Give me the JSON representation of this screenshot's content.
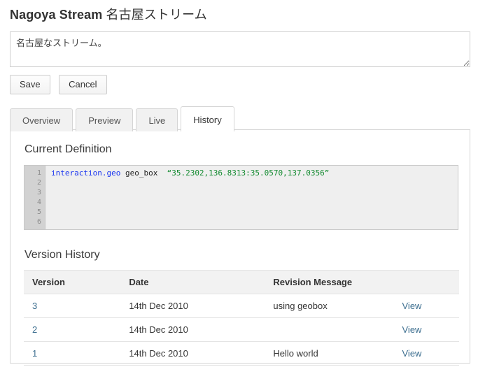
{
  "page": {
    "title_en": "Nagoya Stream ",
    "title_jp": "名古屋ストリーム"
  },
  "description": {
    "value": "名古屋なストリーム。",
    "placeholder": ""
  },
  "actions": {
    "save_label": "Save",
    "cancel_label": "Cancel"
  },
  "tabs": [
    {
      "label": "Overview",
      "active": false
    },
    {
      "label": "Preview",
      "active": false
    },
    {
      "label": "Live",
      "active": false
    },
    {
      "label": "History",
      "active": true
    }
  ],
  "current_definition": {
    "heading": "Current Definition",
    "line_numbers": [
      "1",
      "2",
      "3",
      "4",
      "5",
      "6"
    ],
    "code": {
      "namespace": "interaction.geo",
      "keyword": "geo_box",
      "string": "“35.2302,136.8313:35.0570,137.0356”"
    }
  },
  "version_history": {
    "heading": "Version History",
    "columns": [
      "Version",
      "Date",
      "Revision Message",
      ""
    ],
    "rows": [
      {
        "version": "3",
        "date": "14th Dec 2010",
        "message": "using geobox",
        "action": "View"
      },
      {
        "version": "2",
        "date": "14th Dec 2010",
        "message": "",
        "action": "View"
      },
      {
        "version": "1",
        "date": "14th Dec 2010",
        "message": "Hello world",
        "action": "View"
      }
    ]
  },
  "colors": {
    "link": "#3c6e8f",
    "code_namespace": "#1a35f0",
    "code_string": "#128a2f",
    "panel_border": "#d5d5d5",
    "tab_inactive_bg": "#f1f1f1",
    "table_header_bg": "#f2f2f2"
  }
}
